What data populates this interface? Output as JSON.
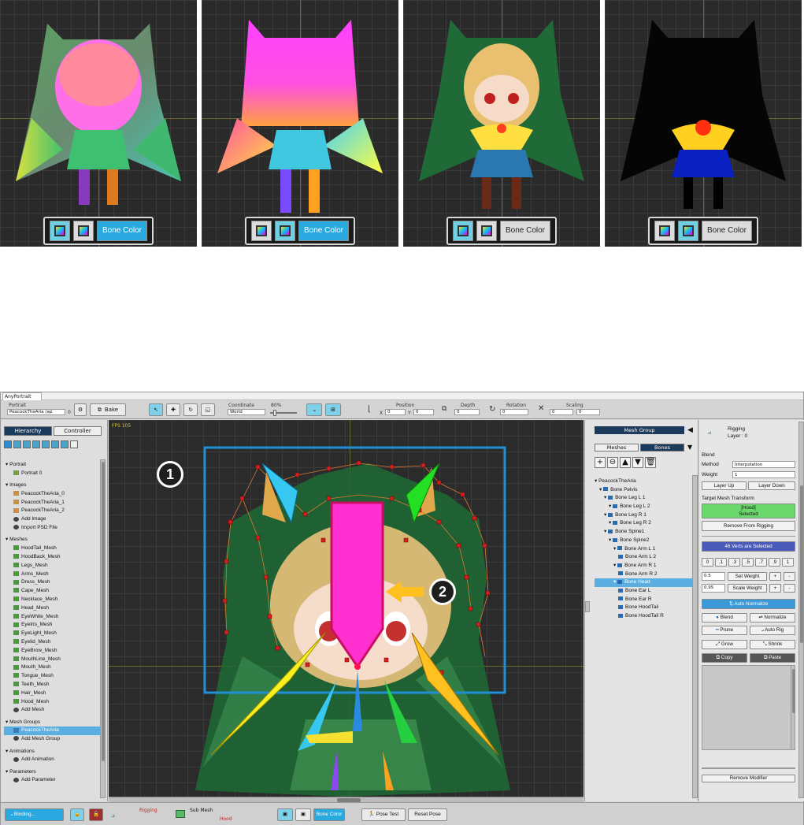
{
  "previews": {
    "bone_color_label": "Bone Color",
    "panels": [
      {
        "mode": "weight-gradient",
        "bone_color_active": true,
        "bg": "#2a2a2a"
      },
      {
        "mode": "bone-colors-only",
        "bone_color_active": false,
        "bg": "#2a2a2a"
      },
      {
        "mode": "textured-selected-weight",
        "bone_color_active": false,
        "bg": "#2a2a2a"
      },
      {
        "mode": "weight-heatmap",
        "bone_color_active": false,
        "bg": "#2a2a2a"
      }
    ]
  },
  "app": {
    "window_tab": "AnyPortrait",
    "toolbar": {
      "portrait_label": "Portrait",
      "portrait_value": "PeacockTheAria (ap",
      "portrait_suffix": "0",
      "bake_label": "Bake",
      "coordinate_label": "Coordinate",
      "coordinate_value": "World",
      "zoom_value": "80%",
      "position_label": "Position",
      "x_label": "X",
      "x_value": "0",
      "y_label": "Y",
      "y_value": "0",
      "depth_label": "Depth",
      "depth_value": "0",
      "rotation_label": "Rotation",
      "rotation_value": "0",
      "scaling_label": "Scaling",
      "scale_x": "0",
      "scale_y": "0"
    },
    "left_panel": {
      "tabs": [
        "Hierarchy",
        "Controller"
      ],
      "tree": [
        {
          "label": "Portrait",
          "kind": "header"
        },
        {
          "label": "Portrait 0",
          "kind": "portrait"
        },
        {
          "label": "",
          "kind": "gap"
        },
        {
          "label": "Images",
          "kind": "header"
        },
        {
          "label": "PeacockTheAria_0",
          "kind": "image"
        },
        {
          "label": "PeacockTheAria_1",
          "kind": "image"
        },
        {
          "label": "PeacockTheAria_2",
          "kind": "image"
        },
        {
          "label": "Add Image",
          "kind": "add"
        },
        {
          "label": "Import PSD File",
          "kind": "add"
        },
        {
          "label": "",
          "kind": "gap"
        },
        {
          "label": "Meshes",
          "kind": "header"
        },
        {
          "label": "HoodTail_Mesh",
          "kind": "mesh"
        },
        {
          "label": "HoodBack_Mesh",
          "kind": "mesh"
        },
        {
          "label": "Legs_Mesh",
          "kind": "mesh"
        },
        {
          "label": "Arms_Mesh",
          "kind": "mesh"
        },
        {
          "label": "Dress_Mesh",
          "kind": "mesh"
        },
        {
          "label": "Cape_Mesh",
          "kind": "mesh"
        },
        {
          "label": "Necklace_Mesh",
          "kind": "mesh"
        },
        {
          "label": "Head_Mesh",
          "kind": "mesh"
        },
        {
          "label": "EyeWhite_Mesh",
          "kind": "mesh"
        },
        {
          "label": "EyeIris_Mesh",
          "kind": "mesh"
        },
        {
          "label": "EyeLight_Mesh",
          "kind": "mesh"
        },
        {
          "label": "Eyelid_Mesh",
          "kind": "mesh"
        },
        {
          "label": "EyeBrow_Mesh",
          "kind": "mesh"
        },
        {
          "label": "MouthLine_Mesh",
          "kind": "mesh"
        },
        {
          "label": "Mouth_Mesh",
          "kind": "mesh"
        },
        {
          "label": "Tongue_Mesh",
          "kind": "mesh"
        },
        {
          "label": "Teeth_Mesh",
          "kind": "mesh"
        },
        {
          "label": "Hair_Mesh",
          "kind": "mesh"
        },
        {
          "label": "Hood_Mesh",
          "kind": "mesh"
        },
        {
          "label": "Add Mesh",
          "kind": "add"
        },
        {
          "label": "",
          "kind": "gap"
        },
        {
          "label": "Mesh Groups",
          "kind": "header"
        },
        {
          "label": "PeacockTheAria",
          "kind": "group",
          "selected": true
        },
        {
          "label": "Add Mesh Group",
          "kind": "add"
        },
        {
          "label": "",
          "kind": "gap"
        },
        {
          "label": "Animations",
          "kind": "header"
        },
        {
          "label": "Add Animation",
          "kind": "add"
        },
        {
          "label": "",
          "kind": "gap"
        },
        {
          "label": "Parameters",
          "kind": "header"
        },
        {
          "label": "Add Parameter",
          "kind": "add"
        }
      ]
    },
    "viewport": {
      "fps": "FPS 105",
      "callout_1": "1",
      "callout_2": "2"
    },
    "mesh_group_panel": {
      "title": "Mesh Group",
      "tabs": [
        "Meshes",
        "Bones"
      ],
      "bones": [
        {
          "label": "PeacockTheAria",
          "indent": 0,
          "root": true
        },
        {
          "label": "Bone Pelvis",
          "indent": 1
        },
        {
          "label": "Bone Leg L 1",
          "indent": 2
        },
        {
          "label": "Bone Leg L 2",
          "indent": 3
        },
        {
          "label": "Bone Leg R 1",
          "indent": 2
        },
        {
          "label": "Bone Leg R 2",
          "indent": 3
        },
        {
          "label": "Bone Spine1",
          "indent": 2
        },
        {
          "label": "Bone Spine2",
          "indent": 3
        },
        {
          "label": "Bone Arm L 1",
          "indent": 4
        },
        {
          "label": "Bone Arm L 2",
          "indent": 5
        },
        {
          "label": "Bone Arm R 1",
          "indent": 4
        },
        {
          "label": "Bone Arm R 2",
          "indent": 5
        },
        {
          "label": "Bone Head",
          "indent": 4,
          "selected": true
        },
        {
          "label": "Bone Ear L",
          "indent": 5
        },
        {
          "label": "Bone Ear R",
          "indent": 5
        },
        {
          "label": "Bone HoodTail",
          "indent": 5
        },
        {
          "label": "Bone HoodTail R",
          "indent": 5
        }
      ]
    },
    "right_panel": {
      "modifier_name": "Rigging",
      "layer": "Layer : 0",
      "blend_label": "Blend",
      "method_label": "Method",
      "method_value": "Interpolation",
      "weight_label": "Weight",
      "weight_value": "1",
      "layer_up": "Layer Up",
      "layer_down": "Layer Down",
      "target_label": "Target Mesh Transform",
      "target_name": "[Hood]",
      "target_state": "Selected",
      "remove_rigging": "Remove From Rigging",
      "verts_selected": "46 Verts are Selected",
      "presets": [
        "0",
        ".1",
        ".3",
        ".5",
        ".7",
        ".9",
        "1"
      ],
      "set_weight_value": "0.5",
      "set_weight": "Set Weight",
      "scale_weight_value": "0.95",
      "scale_weight": "Scale Weight",
      "plus": "+",
      "minus": "-",
      "auto_normalize": "Auto Normalize",
      "blend": "Blend",
      "normalize": "Normalize",
      "prune": "Prune",
      "auto_rig": "Auto Rig",
      "grow": "Grow",
      "shrink": "Shrink",
      "copy": "Copy",
      "paste": "Paste",
      "remove_modifier": "Remove Modifier"
    },
    "bottom_bar": {
      "binding": "Binding...",
      "rigging": "Rigging",
      "sub_mesh": "Sub Mesh",
      "hood": "Hood",
      "bone_color": "Bone Color",
      "pose_test": "Pose Test",
      "reset_pose": "Reset Pose"
    },
    "colors": {
      "accent_blue": "#2aa8e0",
      "selection": "#5aaee0",
      "panel_navy": "#1b3a5c",
      "verts_bar": "#4a5ab8",
      "target_green": "#6bd86b",
      "callout_box": "#1f8fd8",
      "selected_bone": "#ff2fd0"
    }
  }
}
